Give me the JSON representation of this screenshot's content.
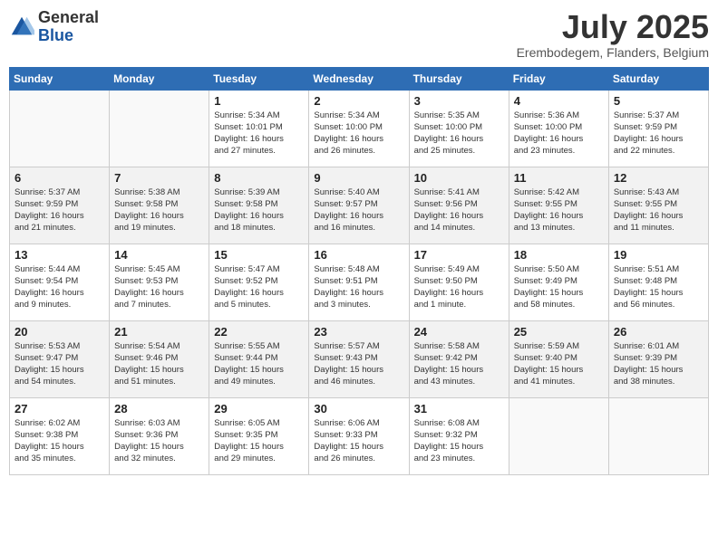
{
  "header": {
    "logo_general": "General",
    "logo_blue": "Blue",
    "title": "July 2025",
    "location": "Erembodegem, Flanders, Belgium"
  },
  "weekdays": [
    "Sunday",
    "Monday",
    "Tuesday",
    "Wednesday",
    "Thursday",
    "Friday",
    "Saturday"
  ],
  "weeks": [
    [
      {
        "day": "",
        "info": ""
      },
      {
        "day": "",
        "info": ""
      },
      {
        "day": "1",
        "info": "Sunrise: 5:34 AM\nSunset: 10:01 PM\nDaylight: 16 hours\nand 27 minutes."
      },
      {
        "day": "2",
        "info": "Sunrise: 5:34 AM\nSunset: 10:00 PM\nDaylight: 16 hours\nand 26 minutes."
      },
      {
        "day": "3",
        "info": "Sunrise: 5:35 AM\nSunset: 10:00 PM\nDaylight: 16 hours\nand 25 minutes."
      },
      {
        "day": "4",
        "info": "Sunrise: 5:36 AM\nSunset: 10:00 PM\nDaylight: 16 hours\nand 23 minutes."
      },
      {
        "day": "5",
        "info": "Sunrise: 5:37 AM\nSunset: 9:59 PM\nDaylight: 16 hours\nand 22 minutes."
      }
    ],
    [
      {
        "day": "6",
        "info": "Sunrise: 5:37 AM\nSunset: 9:59 PM\nDaylight: 16 hours\nand 21 minutes."
      },
      {
        "day": "7",
        "info": "Sunrise: 5:38 AM\nSunset: 9:58 PM\nDaylight: 16 hours\nand 19 minutes."
      },
      {
        "day": "8",
        "info": "Sunrise: 5:39 AM\nSunset: 9:58 PM\nDaylight: 16 hours\nand 18 minutes."
      },
      {
        "day": "9",
        "info": "Sunrise: 5:40 AM\nSunset: 9:57 PM\nDaylight: 16 hours\nand 16 minutes."
      },
      {
        "day": "10",
        "info": "Sunrise: 5:41 AM\nSunset: 9:56 PM\nDaylight: 16 hours\nand 14 minutes."
      },
      {
        "day": "11",
        "info": "Sunrise: 5:42 AM\nSunset: 9:55 PM\nDaylight: 16 hours\nand 13 minutes."
      },
      {
        "day": "12",
        "info": "Sunrise: 5:43 AM\nSunset: 9:55 PM\nDaylight: 16 hours\nand 11 minutes."
      }
    ],
    [
      {
        "day": "13",
        "info": "Sunrise: 5:44 AM\nSunset: 9:54 PM\nDaylight: 16 hours\nand 9 minutes."
      },
      {
        "day": "14",
        "info": "Sunrise: 5:45 AM\nSunset: 9:53 PM\nDaylight: 16 hours\nand 7 minutes."
      },
      {
        "day": "15",
        "info": "Sunrise: 5:47 AM\nSunset: 9:52 PM\nDaylight: 16 hours\nand 5 minutes."
      },
      {
        "day": "16",
        "info": "Sunrise: 5:48 AM\nSunset: 9:51 PM\nDaylight: 16 hours\nand 3 minutes."
      },
      {
        "day": "17",
        "info": "Sunrise: 5:49 AM\nSunset: 9:50 PM\nDaylight: 16 hours\nand 1 minute."
      },
      {
        "day": "18",
        "info": "Sunrise: 5:50 AM\nSunset: 9:49 PM\nDaylight: 15 hours\nand 58 minutes."
      },
      {
        "day": "19",
        "info": "Sunrise: 5:51 AM\nSunset: 9:48 PM\nDaylight: 15 hours\nand 56 minutes."
      }
    ],
    [
      {
        "day": "20",
        "info": "Sunrise: 5:53 AM\nSunset: 9:47 PM\nDaylight: 15 hours\nand 54 minutes."
      },
      {
        "day": "21",
        "info": "Sunrise: 5:54 AM\nSunset: 9:46 PM\nDaylight: 15 hours\nand 51 minutes."
      },
      {
        "day": "22",
        "info": "Sunrise: 5:55 AM\nSunset: 9:44 PM\nDaylight: 15 hours\nand 49 minutes."
      },
      {
        "day": "23",
        "info": "Sunrise: 5:57 AM\nSunset: 9:43 PM\nDaylight: 15 hours\nand 46 minutes."
      },
      {
        "day": "24",
        "info": "Sunrise: 5:58 AM\nSunset: 9:42 PM\nDaylight: 15 hours\nand 43 minutes."
      },
      {
        "day": "25",
        "info": "Sunrise: 5:59 AM\nSunset: 9:40 PM\nDaylight: 15 hours\nand 41 minutes."
      },
      {
        "day": "26",
        "info": "Sunrise: 6:01 AM\nSunset: 9:39 PM\nDaylight: 15 hours\nand 38 minutes."
      }
    ],
    [
      {
        "day": "27",
        "info": "Sunrise: 6:02 AM\nSunset: 9:38 PM\nDaylight: 15 hours\nand 35 minutes."
      },
      {
        "day": "28",
        "info": "Sunrise: 6:03 AM\nSunset: 9:36 PM\nDaylight: 15 hours\nand 32 minutes."
      },
      {
        "day": "29",
        "info": "Sunrise: 6:05 AM\nSunset: 9:35 PM\nDaylight: 15 hours\nand 29 minutes."
      },
      {
        "day": "30",
        "info": "Sunrise: 6:06 AM\nSunset: 9:33 PM\nDaylight: 15 hours\nand 26 minutes."
      },
      {
        "day": "31",
        "info": "Sunrise: 6:08 AM\nSunset: 9:32 PM\nDaylight: 15 hours\nand 23 minutes."
      },
      {
        "day": "",
        "info": ""
      },
      {
        "day": "",
        "info": ""
      }
    ]
  ]
}
